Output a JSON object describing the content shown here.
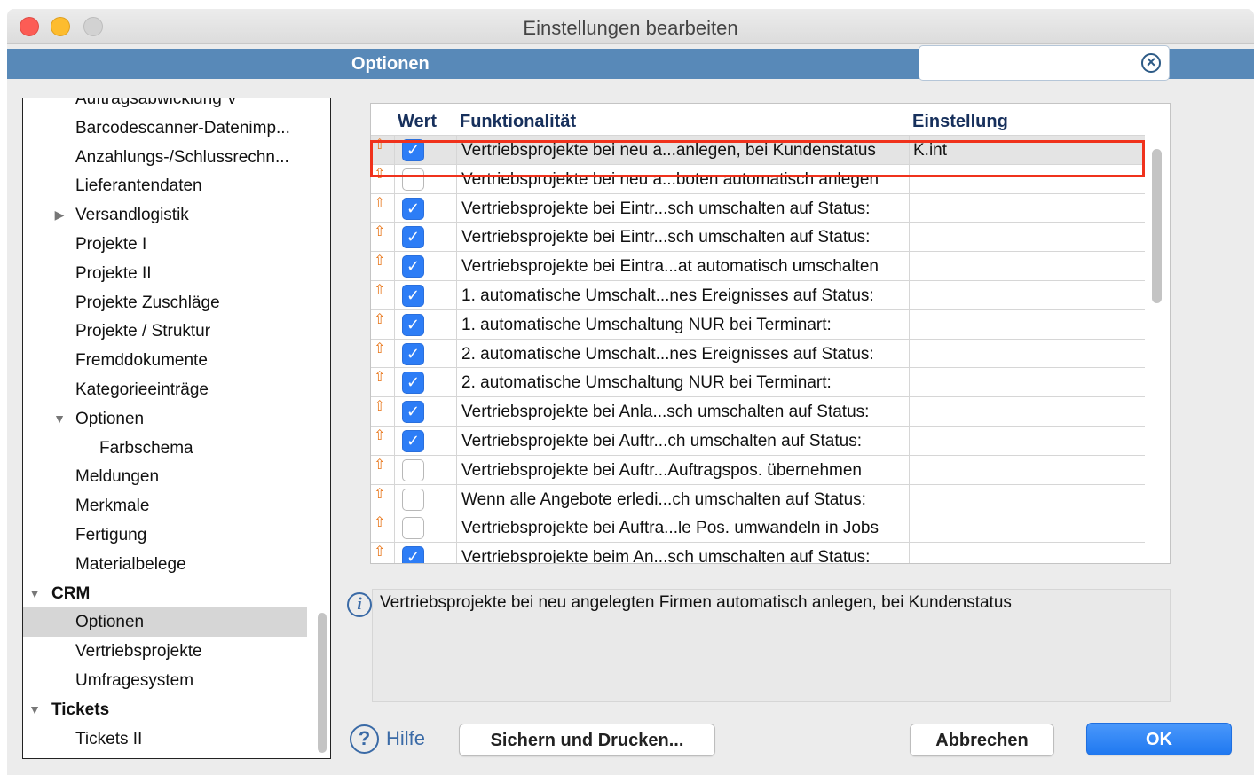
{
  "window": {
    "title": "Einstellungen bearbeiten"
  },
  "header": {
    "title": "Optionen",
    "search": {
      "value": "",
      "placeholder": "",
      "clear_icon": "clear-circle-icon"
    }
  },
  "sidebar": {
    "items": [
      {
        "label": "Auftragsabwicklung V",
        "indent": 1,
        "arrow": "",
        "bold": false,
        "selected": false
      },
      {
        "label": "Barcodescanner-Datenimp...",
        "indent": 1,
        "arrow": "",
        "bold": false,
        "selected": false
      },
      {
        "label": "Anzahlungs-/Schlussrechn...",
        "indent": 1,
        "arrow": "",
        "bold": false,
        "selected": false
      },
      {
        "label": "Lieferantendaten",
        "indent": 1,
        "arrow": "",
        "bold": false,
        "selected": false
      },
      {
        "label": "Versandlogistik",
        "indent": 1,
        "arrow": "right",
        "bold": false,
        "selected": false
      },
      {
        "label": "Projekte I",
        "indent": 1,
        "arrow": "",
        "bold": false,
        "selected": false
      },
      {
        "label": "Projekte II",
        "indent": 1,
        "arrow": "",
        "bold": false,
        "selected": false
      },
      {
        "label": "Projekte Zuschläge",
        "indent": 1,
        "arrow": "",
        "bold": false,
        "selected": false
      },
      {
        "label": "Projekte / Struktur",
        "indent": 1,
        "arrow": "",
        "bold": false,
        "selected": false
      },
      {
        "label": "Fremddokumente",
        "indent": 1,
        "arrow": "",
        "bold": false,
        "selected": false
      },
      {
        "label": "Kategorieeinträge",
        "indent": 1,
        "arrow": "",
        "bold": false,
        "selected": false
      },
      {
        "label": "Optionen",
        "indent": 1,
        "arrow": "down",
        "bold": false,
        "selected": false
      },
      {
        "label": "Farbschema",
        "indent": 2,
        "arrow": "",
        "bold": false,
        "selected": false
      },
      {
        "label": "Meldungen",
        "indent": 1,
        "arrow": "",
        "bold": false,
        "selected": false
      },
      {
        "label": "Merkmale",
        "indent": 1,
        "arrow": "",
        "bold": false,
        "selected": false
      },
      {
        "label": "Fertigung",
        "indent": 1,
        "arrow": "",
        "bold": false,
        "selected": false
      },
      {
        "label": "Materialbelege",
        "indent": 1,
        "arrow": "",
        "bold": false,
        "selected": false
      },
      {
        "label": "CRM",
        "indent": 0,
        "arrow": "down",
        "bold": true,
        "selected": false
      },
      {
        "label": "Optionen",
        "indent": 1,
        "arrow": "",
        "bold": false,
        "selected": true
      },
      {
        "label": "Vertriebsprojekte",
        "indent": 1,
        "arrow": "",
        "bold": false,
        "selected": false
      },
      {
        "label": "Umfragesystem",
        "indent": 1,
        "arrow": "",
        "bold": false,
        "selected": false
      },
      {
        "label": "Tickets",
        "indent": 0,
        "arrow": "down",
        "bold": true,
        "selected": false
      },
      {
        "label": "Tickets II",
        "indent": 1,
        "arrow": "",
        "bold": false,
        "selected": false
      }
    ]
  },
  "table": {
    "columns": {
      "wert": "Wert",
      "funktion": "Funktionalität",
      "einstellung": "Einstellung"
    },
    "rows": [
      {
        "checked": true,
        "function": "Vertriebsprojekte bei neu a...anlegen, bei Kundenstatus",
        "setting": "K.int",
        "selected": true
      },
      {
        "checked": false,
        "function": "Vertriebsprojekte bei neu a...boten automatisch anlegen",
        "setting": "",
        "selected": false
      },
      {
        "checked": true,
        "function": "Vertriebsprojekte bei Eintr...sch umschalten auf Status:",
        "setting": "",
        "selected": false
      },
      {
        "checked": true,
        "function": "Vertriebsprojekte bei Eintr...sch umschalten auf Status:",
        "setting": "",
        "selected": false
      },
      {
        "checked": true,
        "function": "Vertriebsprojekte bei Eintra...at automatisch umschalten",
        "setting": "",
        "selected": false
      },
      {
        "checked": true,
        "function": "1. automatische Umschalt...nes Ereignisses auf Status:",
        "setting": "",
        "selected": false
      },
      {
        "checked": true,
        "function": "1. automatische Umschaltung NUR bei Terminart:",
        "setting": "",
        "selected": false
      },
      {
        "checked": true,
        "function": "2. automatische Umschalt...nes Ereignisses auf Status:",
        "setting": "",
        "selected": false
      },
      {
        "checked": true,
        "function": "2. automatische Umschaltung NUR bei Terminart:",
        "setting": "",
        "selected": false
      },
      {
        "checked": true,
        "function": "Vertriebsprojekte bei Anla...sch umschalten auf Status:",
        "setting": "",
        "selected": false
      },
      {
        "checked": true,
        "function": "Vertriebsprojekte bei Auftr...ch umschalten auf Status:",
        "setting": "",
        "selected": false
      },
      {
        "checked": false,
        "function": "Vertriebsprojekte bei Auftr...Auftragspos. übernehmen",
        "setting": "",
        "selected": false
      },
      {
        "checked": false,
        "function": "Wenn alle Angebote erledi...ch umschalten auf Status:",
        "setting": "",
        "selected": false
      },
      {
        "checked": false,
        "function": "Vertriebsprojekte bei Auftra...le Pos. umwandeln in Jobs",
        "setting": "",
        "selected": false
      },
      {
        "checked": true,
        "function": "Vertriebsprojekte beim An...sch umschalten auf Status:",
        "setting": "",
        "selected": false
      }
    ]
  },
  "description": {
    "text": "Vertriebsprojekte bei neu angelegten Firmen automatisch anlegen, bei Kundenstatus"
  },
  "footer": {
    "help_label": "Hilfe",
    "print_label": "Sichern und Drucken...",
    "cancel_label": "Abbrechen",
    "ok_label": "OK"
  },
  "colors": {
    "header_bar": "#5889b8",
    "highlight": "#f0321c",
    "checkbox_on": "#2d7df6",
    "ok_button": "#1f78f0",
    "row_icon": "#e8761a"
  }
}
